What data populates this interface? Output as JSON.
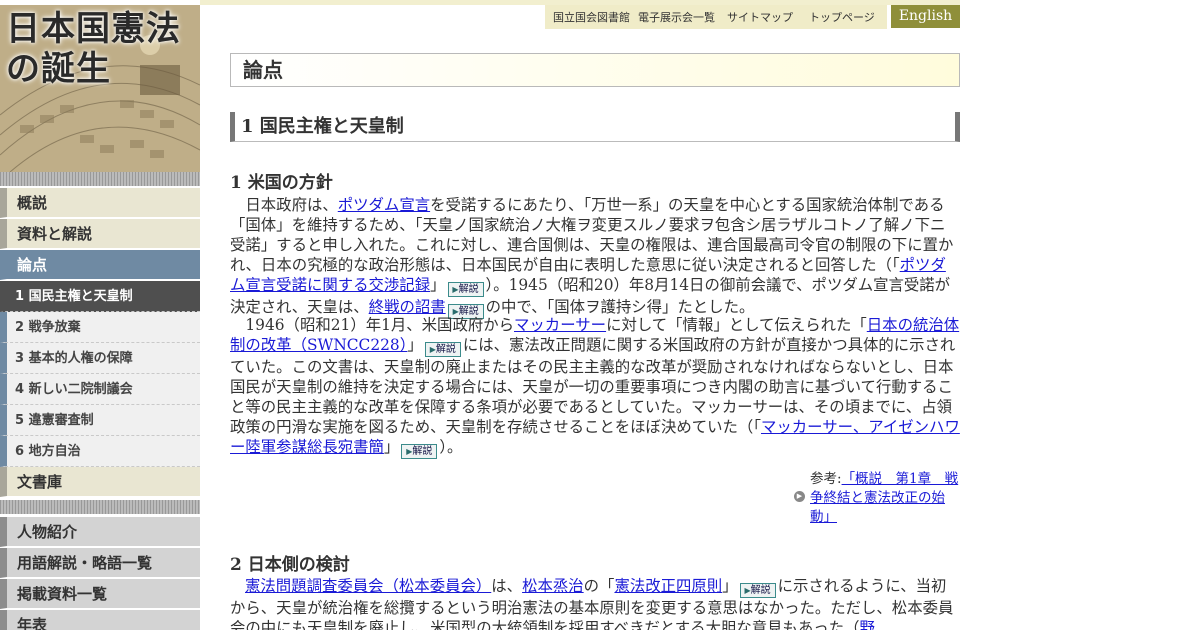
{
  "site": {
    "logo_text": "日本国憲法の誕生"
  },
  "topnav": {
    "items": [
      "国立国会図書館",
      "電子展示会一覧",
      "サイトマップ",
      "トップページ"
    ],
    "english": "English"
  },
  "sidebar": {
    "main_items": [
      "概説",
      "資料と解説",
      "論点"
    ],
    "sub_items": [
      "1 国民主権と天皇制",
      "2 戦争放棄",
      "3 基本的人権の保障",
      "4 新しい二院制議会",
      "5 違憲審査制",
      "6 地方自治"
    ],
    "archive": "文書庫",
    "extra_items": [
      "人物紹介",
      "用語解説・略語一覧",
      "掲載資料一覧",
      "年表"
    ]
  },
  "main": {
    "page_title": "論点",
    "section_title": "1 国民主権と天皇制",
    "sub1": "1 米国の方針",
    "sub2": "2 日本側の検討",
    "kaisetsu": "解説",
    "p1": {
      "t1": "　日本政府は、",
      "l1": "ポツダム宣言",
      "t2": "を受諾するにあたり、「万世一系」の天皇を中心とする国家統治体制である「国体」を維持するため、「天皇ノ国家統治ノ大権ヲ変更スルノ要求ヲ包含シ居ラザルコトノ了解ノ下ニ受諾」すると申し入れた。これに対し、連合国側は、天皇の権限は、連合国最高司令官の制限の下に置かれ、日本の究極的な政治形態は、日本国民が自由に表明した意思に従い決定されると回答した（「",
      "l2": "ポツダム宣言受諾に関する交渉記録",
      "t3": "」",
      "t4": "）。1945（昭和20）年8月14日の御前会議で、ポツダム宣言受諾が決定され、天皇は、",
      "l3": "終戦の詔書",
      "t5": "の中で、「国体ヲ護持シ得」たとした。"
    },
    "p2": {
      "t1": "　1946（昭和21）年1月、米国政府から",
      "l1": "マッカーサー",
      "t2": "に対して「情報」として伝えられた「",
      "l2": "日本の統治体制の改革（SWNCC228）",
      "t3": "」",
      "t4": "には、憲法改正問題に関する米国政府の方針が直接かつ具体的に示されていた。この文書は、天皇制の廃止またはその民主主義的な改革が奨励されなければならないとし、日本国民が天皇制の維持を決定する場合には、天皇が一切の重要事項につき内閣の助言に基づいて行動すること等の民主主義的な改革を保障する条項が必要であるとしていた。マッカーサーは、その頃までに、占領政策の円滑な実施を図るため、天皇制を存続させることをほぼ決めていた（「",
      "l3": "マッカーサー、アイゼンハワー陸軍参謀総長宛書簡",
      "t5": "」",
      "t6": "）。"
    },
    "reference": {
      "prefix": "参考:",
      "link": "「概説　第1章　戦争終結と憲法改正の始動」"
    },
    "p3": {
      "l1": "憲法問題調査委員会（松本委員会）",
      "t1": "は、",
      "l2": "松本烝治",
      "t2": "の「",
      "l3": "憲法改正四原則",
      "t3": "」",
      "t4": "に示されるように、当初から、天皇が統治権を総攬するという明治憲法の基本原則を変更する意思はなかった。ただし、松本委員会の中にも天皇制を廃止し、米国型の大統領制を採用すべきだとする大胆な意見もあった（",
      "l4": "野"
    }
  }
}
